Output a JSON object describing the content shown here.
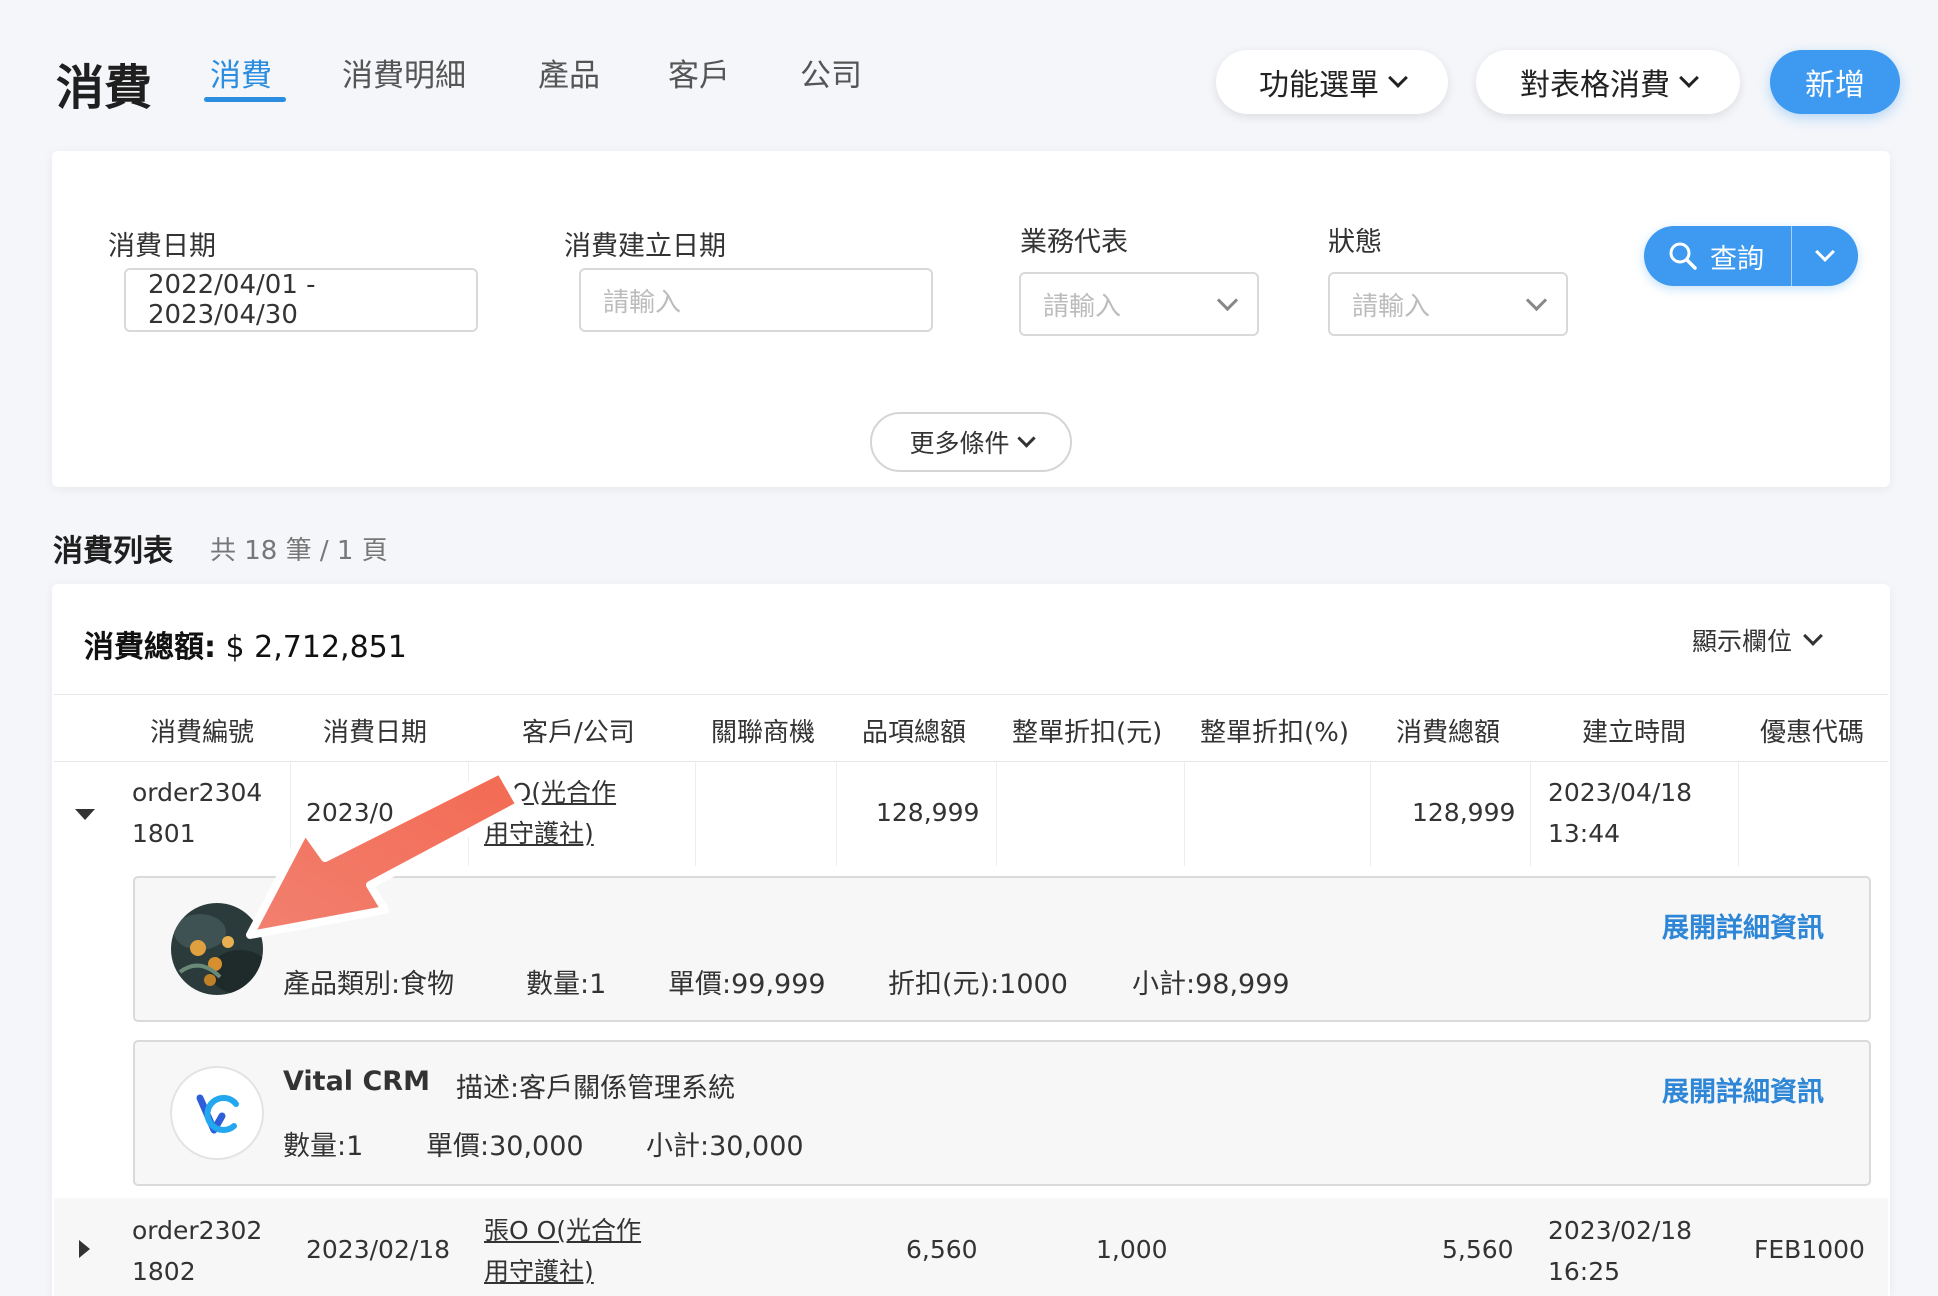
{
  "header": {
    "title": "消費",
    "tabs": [
      {
        "label": "消費",
        "active": true
      },
      {
        "label": "消費明細"
      },
      {
        "label": "產品"
      },
      {
        "label": "客戶"
      },
      {
        "label": "公司"
      }
    ],
    "menu_label": "功能選單",
    "consume_label": "對表格消費",
    "new_label": "新增"
  },
  "filters": {
    "date_label": "消費日期",
    "date_value": "2022/04/01 - 2023/04/30",
    "created_label": "消費建立日期",
    "created_placeholder": "請輸入",
    "sales_label": "業務代表",
    "sales_placeholder": "請輸入",
    "status_label": "狀態",
    "status_placeholder": "請輸入",
    "search_label": "查詢",
    "more_label": "更多條件"
  },
  "list": {
    "title": "消費列表",
    "count": "共 18 筆 / 1 頁",
    "total_label": "消費總額:",
    "total_value": " $ 2,712,851",
    "columns_toggle": "顯示欄位",
    "headers": [
      "消費編號",
      "消費日期",
      "客戶/公司",
      "關聯商機",
      "品項總額",
      "整單折扣(元)",
      "整單折扣(%)",
      "消費總額",
      "建立時間",
      "優惠代碼"
    ],
    "rows": [
      {
        "id1": "order2304",
        "id2": "1801",
        "date": "2023/0",
        "customer1": "O O(光合作",
        "customer2": "用守護社)",
        "items_total": "128,999",
        "discount_amt": "",
        "discount_pct": "",
        "total": "128,999",
        "created1": "2023/04/18",
        "created2": "13:44",
        "coupon": "",
        "details": [
          {
            "name": "",
            "line1": "產品類別:食物",
            "qty": "數量:1",
            "price": "單價:99,999",
            "discount": "折扣(元):1000",
            "subtotal": "小計:98,999",
            "expand": "展開詳細資訊"
          },
          {
            "name": "Vital CRM",
            "desc": "描述:客戶關係管理系統",
            "qty": "數量:1",
            "price": "單價:30,000",
            "subtotal": "小計:30,000",
            "expand": "展開詳細資訊"
          }
        ]
      },
      {
        "id1": "order2302",
        "id2": "1802",
        "date": "2023/02/18",
        "customer1": "張O O(光合作",
        "customer2": "用守護社)",
        "items_total": "6,560",
        "discount_amt": "1,000",
        "discount_pct": "",
        "total": "5,560",
        "created1": "2023/02/18",
        "created2": "16:25",
        "coupon": "FEB1000"
      }
    ]
  },
  "colors": {
    "accent": "#3d9af0",
    "link": "#2e86d6",
    "arrow": "#f07060",
    "background": "#f4f6fa"
  },
  "icons": [
    "chevron-down-icon",
    "search-icon",
    "caret-down-icon",
    "caret-right-icon",
    "product-thumbnail",
    "vital-crm-logo",
    "annotation-arrow"
  ]
}
